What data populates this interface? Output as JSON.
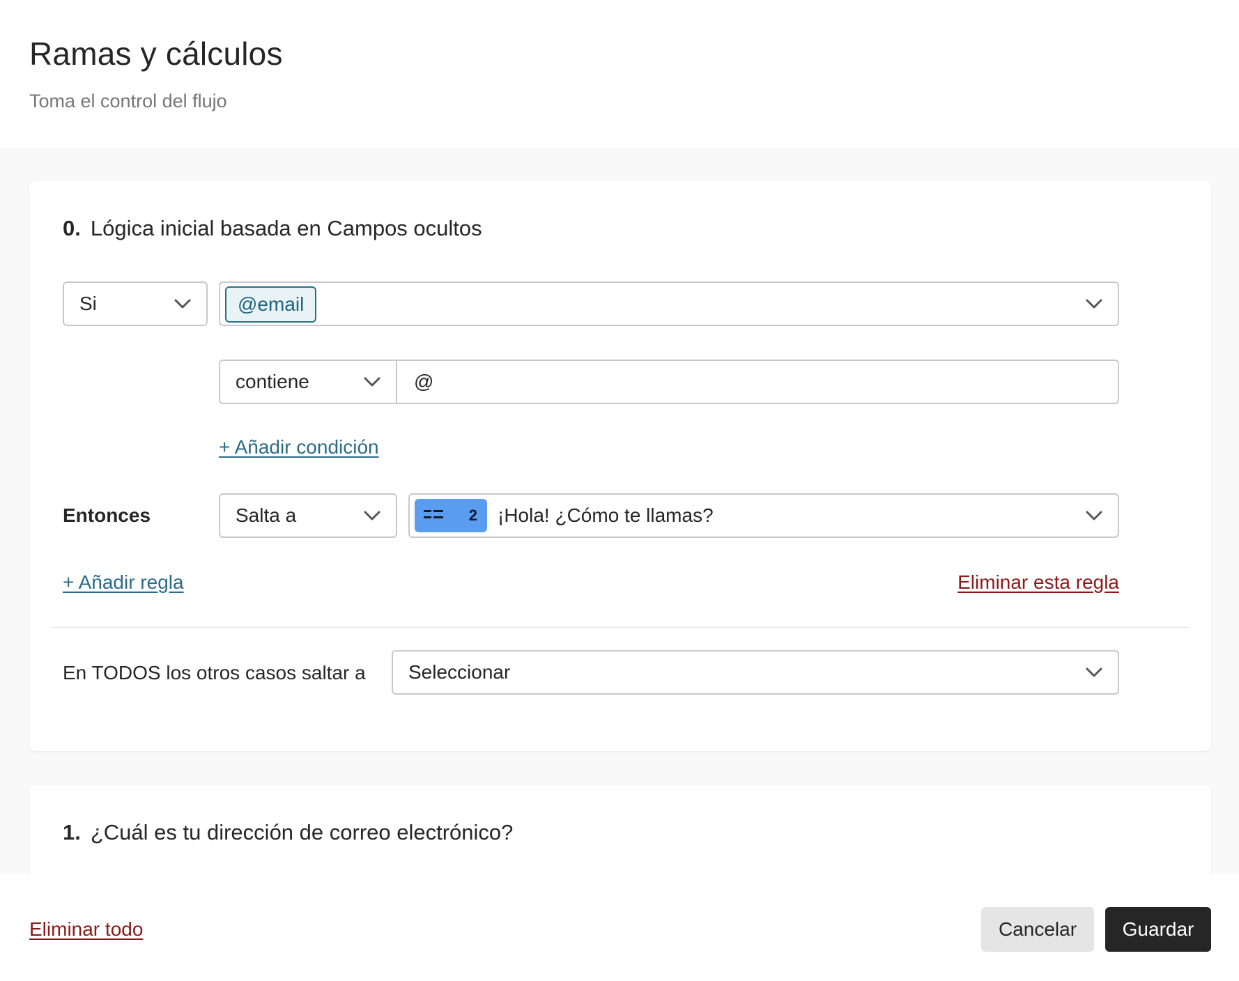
{
  "header": {
    "title": "Ramas y cálculos",
    "subtitle": "Toma el control del flujo"
  },
  "card0": {
    "number": "0.",
    "title": "Lógica inicial basada en Campos ocultos",
    "condition_select": "Si",
    "field_tag": "@email",
    "operator_select": "contiene",
    "operator_value": "@",
    "add_condition": "+ Añadir condición",
    "then_label": "Entonces",
    "action_select": "Salta a",
    "target_question_number": "2",
    "target_question_text": "¡Hola! ¿Cómo te llamas?",
    "add_rule": "+ Añadir regla",
    "delete_rule": "Eliminar esta regla",
    "other_cases_label": "En TODOS los otros casos saltar a",
    "other_cases_select": "Seleccionar"
  },
  "card1": {
    "number": "1.",
    "title": "¿Cuál es tu dirección de correo electrónico?"
  },
  "footer": {
    "delete_all": "Eliminar todo",
    "cancel": "Cancelar",
    "save": "Guardar"
  },
  "icons": {
    "chevron": "chevron-down-icon",
    "question_type": "short-text-icon"
  },
  "colors": {
    "accent_blue": "#2b6b8a",
    "danger_red": "#8b1a1a",
    "badge_blue": "#5a9cf0",
    "primary_button": "#262627"
  }
}
